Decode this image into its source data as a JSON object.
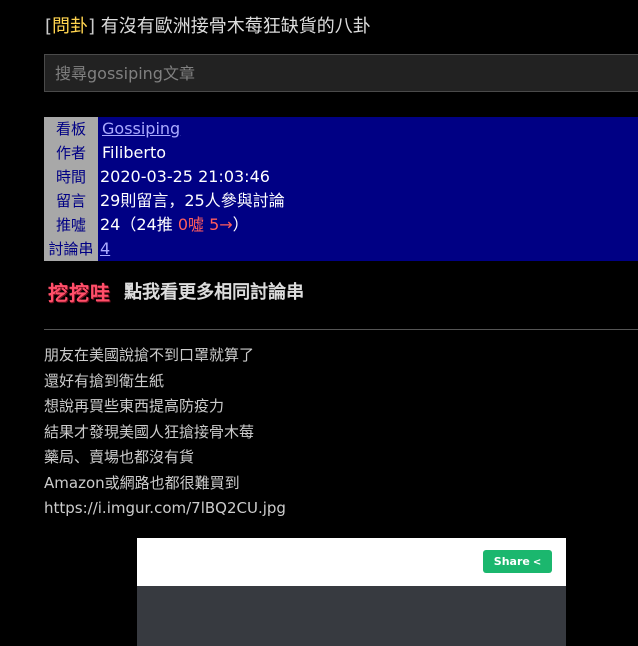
{
  "post": {
    "title_bracket_open": "[",
    "title_tag": "問卦",
    "title_bracket_close": "]",
    "title_text": " 有沒有歐洲接骨木莓狂缺貨的八卦"
  },
  "search": {
    "placeholder": "搜尋gossiping文章",
    "value": ""
  },
  "meta": {
    "board_label": "看板",
    "board_value": "Gossiping",
    "author_label": "作者",
    "author_value": "Filiberto",
    "time_label": "時間",
    "time_value": "2020-03-25 21:03:46",
    "comments_label": "留言",
    "comments_value": "29則留言，25人參與討論",
    "push_label": "推噓",
    "push_value_prefix": "24（24推 ",
    "push_boo": "0噓",
    "push_arrow": " 5→",
    "push_value_suffix": "）",
    "thread_label": "討論串",
    "thread_value": "4"
  },
  "digger": {
    "logo_text": "挖挖哇",
    "link_text": "點我看更多相同討論串"
  },
  "content": {
    "lines": [
      "朋友在美國說搶不到口罩就算了",
      "還好有搶到衛生紙",
      "想說再買些東西提高防疫力",
      "結果才發現美國人狂搶接骨木莓",
      "藥局、賣場也都沒有貨",
      "Amazon或網路也都很難買到"
    ],
    "link": "https://i.imgur.com/7lBQ2CU.jpg"
  },
  "embed": {
    "share_label": "Share",
    "share_icon": "share-icon"
  },
  "colors": {
    "background": "#000000",
    "meta_background": "#000084",
    "meta_label_bg": "#a8a8a8",
    "tag_yellow": "#ffd44f",
    "boo_red": "#ff5d5d",
    "share_green": "#1bb76e",
    "logo_pink": "#ff4f6a"
  }
}
